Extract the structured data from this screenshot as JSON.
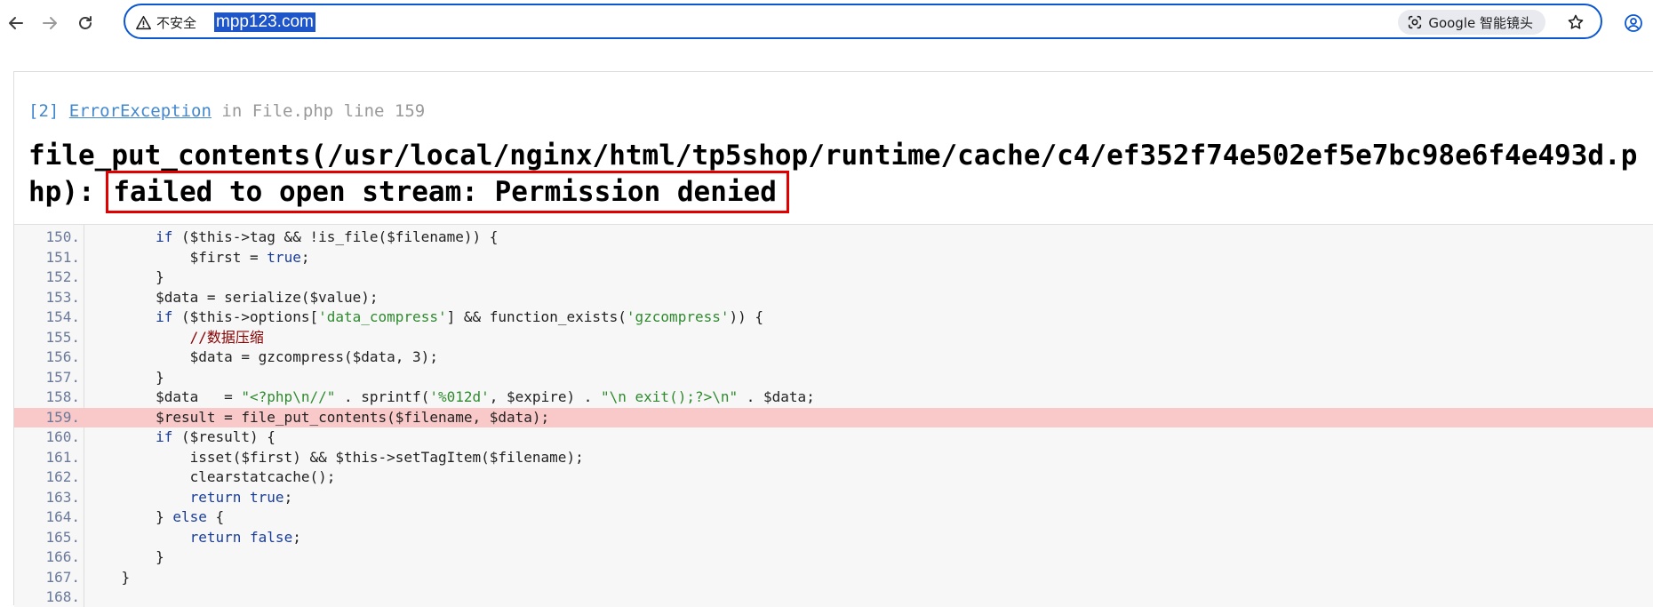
{
  "browser": {
    "security_label": "不安全",
    "url": "mpp123.com",
    "lens_label": "Google 智能镜头",
    "icons": {
      "back": "back-arrow-icon",
      "forward": "forward-arrow-icon",
      "reload": "reload-icon",
      "security": "warning-triangle-icon",
      "lens": "google-lens-icon",
      "bookmark": "star-icon",
      "profile": "profile-icon"
    },
    "accent_color": "#0b57d0"
  },
  "error": {
    "code": "[2]",
    "class_name": "ErrorException",
    "in_text": "in",
    "location": "File.php line 159",
    "message_prefix": "file_put_contents(/usr/local/nginx/html/tp5shop/runtime/cache/c4/ef352f74e502ef5e7bc98e6f4e493d.php):",
    "message_highlight": "failed to open stream: Permission denied",
    "highlight_color": "#e00000"
  },
  "source": {
    "active_line": "159.",
    "lines": [
      {
        "no": "150.",
        "text": "        if ($this->tag && !is_file($filename)) {"
      },
      {
        "no": "151.",
        "text": "            $first = true;"
      },
      {
        "no": "152.",
        "text": "        }"
      },
      {
        "no": "153.",
        "text": "        $data = serialize($value);"
      },
      {
        "no": "154.",
        "text": "        if ($this->options['data_compress'] && function_exists('gzcompress')) {"
      },
      {
        "no": "155.",
        "text": "            //数据压缩"
      },
      {
        "no": "156.",
        "text": "            $data = gzcompress($data, 3);"
      },
      {
        "no": "157.",
        "text": "        }"
      },
      {
        "no": "158.",
        "text": "        $data   = \"<?php\\n//\" . sprintf('%012d', $expire) . \"\\n exit();?>\\n\" . $data;"
      },
      {
        "no": "159.",
        "text": "        $result = file_put_contents($filename, $data);"
      },
      {
        "no": "160.",
        "text": "        if ($result) {"
      },
      {
        "no": "161.",
        "text": "            isset($first) && $this->setTagItem($filename);"
      },
      {
        "no": "162.",
        "text": "            clearstatcache();"
      },
      {
        "no": "163.",
        "text": "            return true;"
      },
      {
        "no": "164.",
        "text": "        } else {"
      },
      {
        "no": "165.",
        "text": "            return false;"
      },
      {
        "no": "166.",
        "text": "        }"
      },
      {
        "no": "167.",
        "text": "    }"
      },
      {
        "no": "168.",
        "text": ""
      }
    ]
  }
}
